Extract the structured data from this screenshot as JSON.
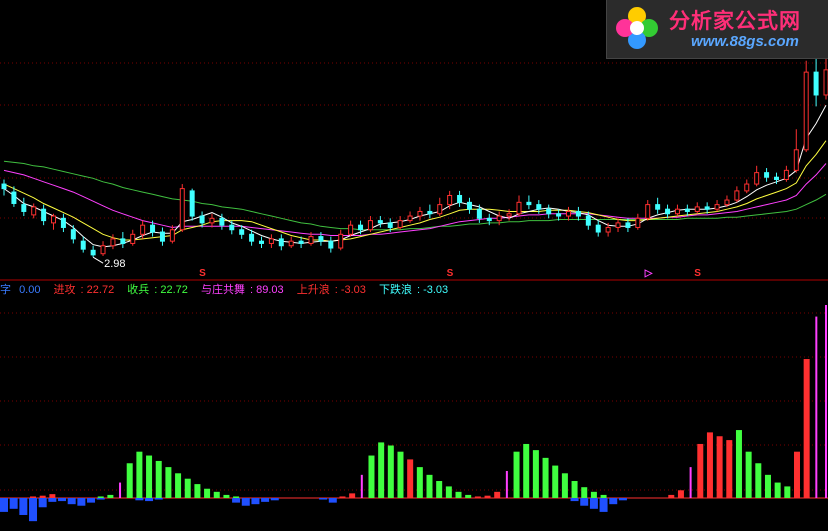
{
  "logo": {
    "title": "分析家公式网",
    "url": "www.88gs.com"
  },
  "indicator_legend": [
    {
      "label": "字",
      "value": "0.00",
      "color": "#3a7bff"
    },
    {
      "label": "进攻",
      "value": "22.72",
      "color": "#ff3030"
    },
    {
      "label": "收兵",
      "value": "22.72",
      "color": "#40ff40"
    },
    {
      "label": "与庄共舞",
      "value": "89.03",
      "color": "#ff40ff"
    },
    {
      "label": "上升浪",
      "value": "-3.03",
      "color": "#ff3030"
    },
    {
      "label": "下跌浪",
      "value": "-3.03",
      "color": "#40ffff"
    }
  ],
  "chart_data": [
    {
      "type": "candlestick",
      "panel": "price",
      "annotation": "2.98",
      "ylim": [
        2.85,
        4.75
      ],
      "signal_marks": [
        "S",
        "S",
        "▷",
        "S"
      ],
      "colors": {
        "up": "#ff3030",
        "down": "#40ffff",
        "ma_short": "#ffffff",
        "ma_mid": "#ffff40",
        "ma_long": "#ff40ff",
        "ma_longest": "#40c040"
      },
      "candles": [
        [
          3.62,
          3.58,
          3.66,
          3.52
        ],
        [
          3.55,
          3.45,
          3.6,
          3.42
        ],
        [
          3.44,
          3.38,
          3.5,
          3.34
        ],
        [
          3.35,
          3.42,
          3.45,
          3.32
        ],
        [
          3.4,
          3.3,
          3.44,
          3.26
        ],
        [
          3.28,
          3.34,
          3.36,
          3.22
        ],
        [
          3.32,
          3.24,
          3.36,
          3.2
        ],
        [
          3.22,
          3.14,
          3.26,
          3.1
        ],
        [
          3.12,
          3.05,
          3.16,
          3.02
        ],
        [
          3.04,
          3.0,
          3.08,
          2.98
        ],
        [
          3.01,
          3.08,
          3.12,
          2.99
        ],
        [
          3.08,
          3.14,
          3.18,
          3.05
        ],
        [
          3.14,
          3.1,
          3.2,
          3.06
        ],
        [
          3.1,
          3.18,
          3.22,
          3.08
        ],
        [
          3.18,
          3.26,
          3.3,
          3.14
        ],
        [
          3.26,
          3.2,
          3.3,
          3.16
        ],
        [
          3.2,
          3.12,
          3.24,
          3.08
        ],
        [
          3.12,
          3.22,
          3.26,
          3.1
        ],
        [
          3.22,
          3.58,
          3.62,
          3.2
        ],
        [
          3.56,
          3.34,
          3.58,
          3.3
        ],
        [
          3.34,
          3.28,
          3.38,
          3.24
        ],
        [
          3.28,
          3.32,
          3.36,
          3.24
        ],
        [
          3.32,
          3.26,
          3.36,
          3.22
        ],
        [
          3.26,
          3.22,
          3.3,
          3.18
        ],
        [
          3.22,
          3.18,
          3.26,
          3.14
        ],
        [
          3.18,
          3.12,
          3.22,
          3.08
        ],
        [
          3.12,
          3.1,
          3.16,
          3.06
        ],
        [
          3.1,
          3.14,
          3.18,
          3.06
        ],
        [
          3.14,
          3.08,
          3.18,
          3.04
        ],
        [
          3.08,
          3.12,
          3.16,
          3.06
        ],
        [
          3.12,
          3.1,
          3.16,
          3.06
        ],
        [
          3.1,
          3.16,
          3.2,
          3.08
        ],
        [
          3.16,
          3.12,
          3.2,
          3.08
        ],
        [
          3.12,
          3.06,
          3.16,
          3.02
        ],
        [
          3.06,
          3.18,
          3.22,
          3.04
        ],
        [
          3.18,
          3.26,
          3.3,
          3.16
        ],
        [
          3.26,
          3.22,
          3.3,
          3.18
        ],
        [
          3.22,
          3.3,
          3.34,
          3.2
        ],
        [
          3.3,
          3.28,
          3.34,
          3.24
        ],
        [
          3.28,
          3.24,
          3.32,
          3.2
        ],
        [
          3.24,
          3.3,
          3.34,
          3.22
        ],
        [
          3.3,
          3.34,
          3.38,
          3.28
        ],
        [
          3.34,
          3.38,
          3.42,
          3.3
        ],
        [
          3.38,
          3.36,
          3.44,
          3.32
        ],
        [
          3.36,
          3.44,
          3.5,
          3.34
        ],
        [
          3.44,
          3.52,
          3.56,
          3.4
        ],
        [
          3.52,
          3.46,
          3.56,
          3.42
        ],
        [
          3.46,
          3.4,
          3.5,
          3.36
        ],
        [
          3.4,
          3.32,
          3.44,
          3.28
        ],
        [
          3.32,
          3.3,
          3.36,
          3.26
        ],
        [
          3.3,
          3.34,
          3.38,
          3.26
        ],
        [
          3.34,
          3.36,
          3.4,
          3.3
        ],
        [
          3.36,
          3.46,
          3.52,
          3.34
        ],
        [
          3.46,
          3.44,
          3.52,
          3.4
        ],
        [
          3.44,
          3.4,
          3.48,
          3.36
        ],
        [
          3.4,
          3.36,
          3.44,
          3.32
        ],
        [
          3.36,
          3.34,
          3.4,
          3.3
        ],
        [
          3.34,
          3.38,
          3.42,
          3.3
        ],
        [
          3.38,
          3.34,
          3.42,
          3.3
        ],
        [
          3.34,
          3.26,
          3.38,
          3.22
        ],
        [
          3.26,
          3.2,
          3.3,
          3.16
        ],
        [
          3.2,
          3.24,
          3.28,
          3.16
        ],
        [
          3.24,
          3.28,
          3.32,
          3.2
        ],
        [
          3.28,
          3.24,
          3.32,
          3.2
        ],
        [
          3.24,
          3.32,
          3.36,
          3.22
        ],
        [
          3.32,
          3.44,
          3.48,
          3.3
        ],
        [
          3.44,
          3.4,
          3.5,
          3.36
        ],
        [
          3.4,
          3.36,
          3.44,
          3.32
        ],
        [
          3.36,
          3.4,
          3.44,
          3.34
        ],
        [
          3.4,
          3.38,
          3.44,
          3.34
        ],
        [
          3.38,
          3.42,
          3.46,
          3.36
        ],
        [
          3.42,
          3.4,
          3.46,
          3.36
        ],
        [
          3.4,
          3.44,
          3.48,
          3.38
        ],
        [
          3.44,
          3.48,
          3.52,
          3.42
        ],
        [
          3.48,
          3.56,
          3.6,
          3.46
        ],
        [
          3.56,
          3.62,
          3.66,
          3.54
        ],
        [
          3.62,
          3.72,
          3.78,
          3.6
        ],
        [
          3.72,
          3.68,
          3.76,
          3.64
        ],
        [
          3.68,
          3.66,
          3.72,
          3.62
        ],
        [
          3.66,
          3.74,
          3.78,
          3.64
        ],
        [
          3.74,
          3.92,
          4.1,
          3.72
        ],
        [
          3.92,
          4.6,
          4.7,
          3.9
        ],
        [
          4.6,
          4.4,
          4.72,
          4.3
        ],
        [
          4.4,
          4.62,
          4.74,
          4.36
        ]
      ],
      "ma_short": [
        3.58,
        3.52,
        3.45,
        3.42,
        3.38,
        3.34,
        3.3,
        3.24,
        3.16,
        3.09,
        3.07,
        3.08,
        3.1,
        3.13,
        3.17,
        3.2,
        3.19,
        3.19,
        3.29,
        3.31,
        3.34,
        3.37,
        3.33,
        3.28,
        3.25,
        3.21,
        3.17,
        3.14,
        3.12,
        3.11,
        3.1,
        3.11,
        3.12,
        3.12,
        3.13,
        3.17,
        3.2,
        3.23,
        3.27,
        3.28,
        3.29,
        3.31,
        3.34,
        3.36,
        3.38,
        3.43,
        3.46,
        3.44,
        3.42,
        3.38,
        3.34,
        3.32,
        3.36,
        3.38,
        3.4,
        3.41,
        3.4,
        3.38,
        3.37,
        3.35,
        3.3,
        3.26,
        3.25,
        3.25,
        3.27,
        3.32,
        3.35,
        3.37,
        3.39,
        3.4,
        3.4,
        3.4,
        3.41,
        3.43,
        3.46,
        3.51,
        3.57,
        3.61,
        3.64,
        3.67,
        3.74,
        4.02,
        4.15,
        4.31
      ],
      "ma_mid": [
        3.62,
        3.58,
        3.54,
        3.5,
        3.45,
        3.41,
        3.37,
        3.33,
        3.28,
        3.23,
        3.18,
        3.15,
        3.13,
        3.13,
        3.14,
        3.15,
        3.16,
        3.17,
        3.22,
        3.24,
        3.26,
        3.29,
        3.3,
        3.3,
        3.3,
        3.29,
        3.26,
        3.23,
        3.2,
        3.17,
        3.15,
        3.13,
        3.13,
        3.12,
        3.13,
        3.14,
        3.16,
        3.18,
        3.2,
        3.22,
        3.24,
        3.26,
        3.28,
        3.31,
        3.33,
        3.36,
        3.39,
        3.4,
        3.4,
        3.4,
        3.39,
        3.38,
        3.38,
        3.38,
        3.38,
        3.39,
        3.39,
        3.39,
        3.38,
        3.37,
        3.35,
        3.33,
        3.31,
        3.3,
        3.3,
        3.31,
        3.32,
        3.33,
        3.34,
        3.35,
        3.36,
        3.37,
        3.38,
        3.4,
        3.42,
        3.45,
        3.49,
        3.52,
        3.55,
        3.58,
        3.63,
        3.78,
        3.88,
        4.0
      ],
      "ma_long": [
        3.74,
        3.72,
        3.7,
        3.67,
        3.64,
        3.61,
        3.58,
        3.55,
        3.51,
        3.47,
        3.43,
        3.39,
        3.36,
        3.33,
        3.3,
        3.28,
        3.26,
        3.24,
        3.25,
        3.25,
        3.25,
        3.25,
        3.25,
        3.25,
        3.25,
        3.24,
        3.23,
        3.22,
        3.21,
        3.2,
        3.19,
        3.18,
        3.18,
        3.17,
        3.17,
        3.17,
        3.17,
        3.18,
        3.18,
        3.19,
        3.2,
        3.21,
        3.22,
        3.23,
        3.25,
        3.27,
        3.29,
        3.3,
        3.31,
        3.32,
        3.32,
        3.33,
        3.34,
        3.35,
        3.35,
        3.36,
        3.36,
        3.36,
        3.36,
        3.36,
        3.35,
        3.34,
        3.33,
        3.32,
        3.32,
        3.32,
        3.32,
        3.33,
        3.33,
        3.34,
        3.35,
        3.35,
        3.36,
        3.37,
        3.38,
        3.4,
        3.42,
        3.44,
        3.46,
        3.48,
        3.52,
        3.62,
        3.7,
        3.8
      ],
      "ma_longest": [
        3.82,
        3.81,
        3.8,
        3.78,
        3.77,
        3.75,
        3.73,
        3.71,
        3.69,
        3.67,
        3.64,
        3.62,
        3.59,
        3.57,
        3.55,
        3.53,
        3.51,
        3.49,
        3.48,
        3.47,
        3.45,
        3.44,
        3.42,
        3.41,
        3.4,
        3.38,
        3.36,
        3.34,
        3.32,
        3.3,
        3.28,
        3.27,
        3.25,
        3.24,
        3.23,
        3.23,
        3.22,
        3.22,
        3.22,
        3.22,
        3.22,
        3.23,
        3.23,
        3.24,
        3.25,
        3.25,
        3.26,
        3.27,
        3.27,
        3.28,
        3.28,
        3.29,
        3.29,
        3.3,
        3.3,
        3.3,
        3.31,
        3.31,
        3.31,
        3.31,
        3.31,
        3.31,
        3.31,
        3.31,
        3.31,
        3.31,
        3.31,
        3.31,
        3.31,
        3.32,
        3.32,
        3.32,
        3.32,
        3.33,
        3.33,
        3.34,
        3.35,
        3.36,
        3.37,
        3.38,
        3.4,
        3.44,
        3.48,
        3.53
      ]
    },
    {
      "type": "bar",
      "panel": "indicator",
      "ylim": [
        -40,
        250
      ],
      "positive_bars": [
        0,
        0,
        0,
        2,
        3,
        5,
        0,
        0,
        0,
        0,
        2,
        4,
        20,
        45,
        60,
        55,
        48,
        40,
        32,
        25,
        18,
        12,
        8,
        4,
        2,
        0,
        0,
        0,
        0,
        0,
        0,
        0,
        0,
        0,
        0,
        2,
        6,
        30,
        55,
        72,
        68,
        60,
        50,
        40,
        30,
        22,
        15,
        8,
        4,
        2,
        3,
        8,
        35,
        60,
        70,
        62,
        52,
        42,
        32,
        22,
        14,
        8,
        4,
        0,
        0,
        0,
        0,
        0,
        0,
        4,
        10,
        40,
        70,
        85,
        80,
        75,
        88,
        60,
        45,
        30,
        20,
        15,
        60,
        180,
        235,
        250
      ],
      "positive_colors": [
        "",
        "",
        "",
        "r",
        "r",
        "r",
        "",
        "",
        "",
        "",
        "g",
        "g",
        "m",
        "g",
        "g",
        "g",
        "g",
        "g",
        "g",
        "g",
        "g",
        "g",
        "g",
        "g",
        "g",
        "",
        "",
        "",
        "",
        "",
        "",
        "",
        "",
        "",
        "",
        "r",
        "r",
        "m",
        "g",
        "g",
        "g",
        "g",
        "r",
        "g",
        "g",
        "g",
        "g",
        "g",
        "g",
        "r",
        "r",
        "r",
        "m",
        "g",
        "g",
        "g",
        "g",
        "g",
        "g",
        "g",
        "g",
        "g",
        "g",
        "",
        "",
        "",
        "",
        "",
        "",
        "r",
        "r",
        "m",
        "r",
        "r",
        "r",
        "r",
        "g",
        "g",
        "g",
        "g",
        "g",
        "g",
        "r",
        "r",
        "m",
        "m"
      ],
      "negative_bars": [
        -18,
        -14,
        -22,
        -30,
        -12,
        -5,
        -4,
        -8,
        -10,
        -6,
        -2,
        0,
        0,
        0,
        -3,
        -4,
        -2,
        0,
        0,
        0,
        0,
        0,
        0,
        0,
        -6,
        -10,
        -8,
        -5,
        -3,
        0,
        0,
        0,
        0,
        -2,
        -6,
        0,
        0,
        0,
        0,
        0,
        0,
        0,
        0,
        0,
        0,
        0,
        0,
        0,
        0,
        0,
        0,
        0,
        0,
        0,
        0,
        0,
        0,
        0,
        0,
        -4,
        -10,
        -14,
        -18,
        -8,
        -3,
        0,
        0,
        0,
        0,
        0,
        0,
        0,
        0,
        0,
        0,
        0,
        0,
        0,
        0,
        0,
        0,
        0,
        0,
        0
      ]
    }
  ]
}
